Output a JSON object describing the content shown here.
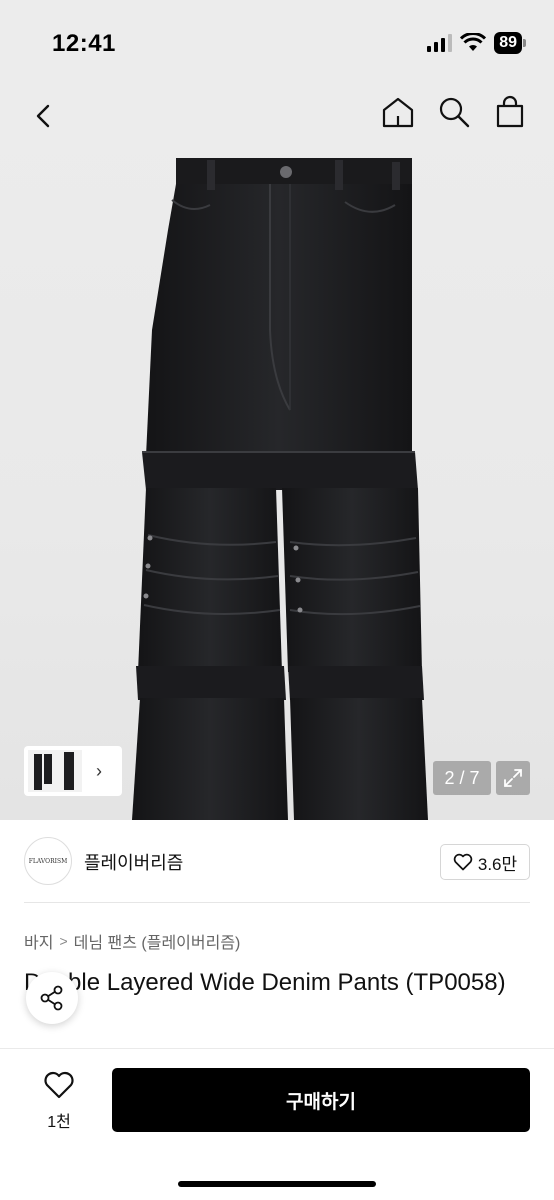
{
  "status_bar": {
    "time": "12:41",
    "battery": "89",
    "icons": [
      "signal-icon",
      "wifi-icon",
      "battery-icon"
    ]
  },
  "nav": {
    "icons": [
      "back-icon",
      "home-icon",
      "search-icon",
      "cart-icon"
    ]
  },
  "gallery": {
    "counter": "2 / 7",
    "thumbnail_chevron": "›",
    "icons": [
      "expand-icon",
      "chevron-right-icon"
    ]
  },
  "seller": {
    "logo_text": "FLAVORISM",
    "name": "플레이버리즘",
    "like_count": "3.6만",
    "icons": [
      "heart-icon"
    ]
  },
  "breadcrumb": {
    "items": [
      "바지",
      "데님 팬츠 (플레이버리즘)"
    ],
    "separator": ">"
  },
  "product": {
    "title": "Double Layered Wide Denim Pants (TP0058)"
  },
  "bottom_bar": {
    "wish_count": "1천",
    "buy_label": "구매하기",
    "icons": [
      "heart-outline-icon",
      "share-icon"
    ]
  },
  "colors": {
    "background": "#ffffff",
    "hero_bg": "#ececec",
    "buy_button": "#000000",
    "denim": "#1c1c1e"
  }
}
